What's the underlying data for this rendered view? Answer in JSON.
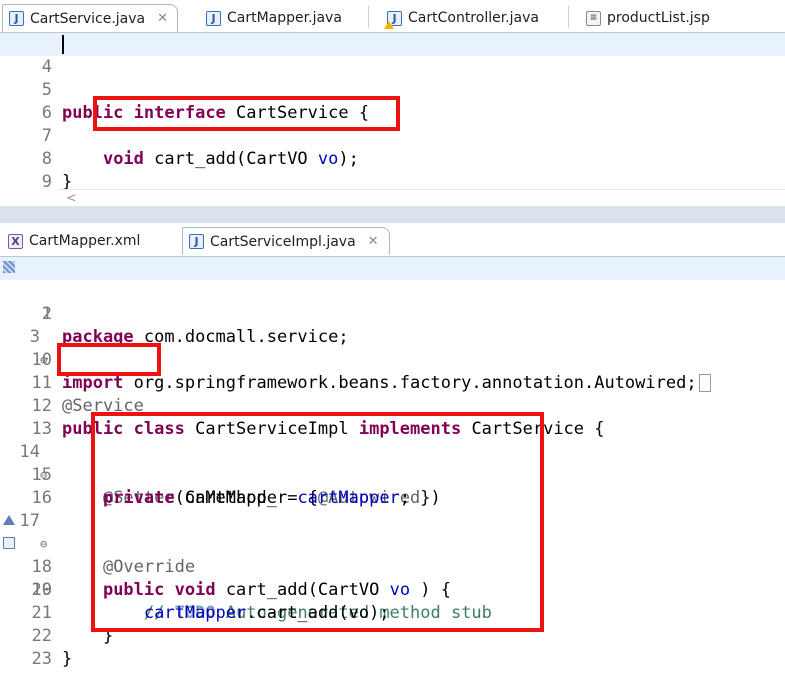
{
  "top_tabs": [
    {
      "label": "CartService.java",
      "icon": "java-file-icon",
      "active": true,
      "close": "✕"
    },
    {
      "label": "CartMapper.java",
      "icon": "java-file-icon"
    },
    {
      "label": "CartController.java",
      "icon": "java-file-warning-icon"
    },
    {
      "label": "productList.jsp",
      "icon": "jsp-file-icon"
    }
  ],
  "bottom_tabs": [
    {
      "label": "CartMapper.xml",
      "icon": "xml-file-icon"
    },
    {
      "label": "CartServiceImpl.java",
      "icon": "java-file-icon",
      "active": true,
      "close": "✕"
    }
  ],
  "top_editor": {
    "lines": [
      {
        "num": "4"
      },
      {
        "num": "5",
        "tokens": [
          [
            "kw",
            "public"
          ],
          [
            "",
            "  "
          ],
          [
            "kw",
            "interface"
          ],
          [
            "",
            " CartService {"
          ]
        ]
      },
      {
        "num": "6"
      },
      {
        "num": "7",
        "tokens": [
          [
            "",
            "    "
          ],
          [
            "kw",
            "void"
          ],
          [
            "",
            " cart_add(CartVO "
          ],
          [
            "fld",
            "vo"
          ],
          [
            "",
            ");"
          ]
        ]
      },
      {
        "num": "8",
        "tokens": [
          [
            "",
            "}"
          ]
        ]
      },
      {
        "num": "9"
      }
    ],
    "scroll_indicator": "<"
  },
  "bottom_editor": {
    "lines": [
      {
        "num": "1",
        "tokens": [
          [
            "kw",
            "package"
          ],
          [
            "",
            " com.docmall.service;"
          ]
        ]
      },
      {
        "num": "2"
      },
      {
        "num": "3",
        "fold": "⊕",
        "tokens": [
          [
            "kw",
            "import"
          ],
          [
            "",
            " org.springframework.beans.factory.annotation.Autowired;"
          ]
        ]
      },
      {
        "num": "10"
      },
      {
        "num": "11",
        "tokens": [
          [
            "ann",
            "@Service"
          ]
        ]
      },
      {
        "num": "12",
        "tokens": [
          [
            "kw",
            "public"
          ],
          [
            "",
            ""
          ],
          [
            "kw",
            " class"
          ],
          [
            "",
            " CartServiceImpl "
          ],
          [
            "kw",
            "implements"
          ],
          [
            "",
            " CartService {"
          ]
        ]
      },
      {
        "num": "13"
      },
      {
        "num": "14",
        "fold": "⊖",
        "tokens": [
          [
            "",
            "    "
          ],
          [
            "ann",
            "@Setter"
          ],
          [
            "",
            "(onMethod_ = {"
          ],
          [
            "ann",
            "@Autowired"
          ],
          [
            "",
            "})"
          ]
        ]
      },
      {
        "num": "15",
        "tokens": [
          [
            "",
            "    "
          ],
          [
            "kw",
            "private"
          ],
          [
            "",
            " CartMapper "
          ],
          [
            "fld",
            "cartMapper"
          ],
          [
            "",
            ";"
          ]
        ]
      },
      {
        "num": "16"
      },
      {
        "num": "17",
        "fold": "⊖",
        "tokens": [
          [
            "",
            "    "
          ],
          [
            "ann",
            "@Override"
          ]
        ]
      },
      {
        "num": "18",
        "tokens": [
          [
            "",
            "    "
          ],
          [
            "kw",
            "public"
          ],
          [
            "",
            " "
          ],
          [
            "kw",
            "void"
          ],
          [
            "",
            " cart_add(CartVO "
          ],
          [
            "fld",
            "vo"
          ],
          [
            "",
            " ) {"
          ]
        ]
      },
      {
        "num": "19",
        "tokens": [
          [
            "",
            "        "
          ],
          [
            "cmt",
            "// "
          ],
          [
            "todo",
            "TODO"
          ],
          [
            "cmt",
            " Auto-generated method stub"
          ]
        ]
      },
      {
        "num": "20",
        "tokens": [
          [
            "",
            "        "
          ],
          [
            "fld",
            "cartMapper"
          ],
          [
            "",
            ".cart_add(vo);"
          ]
        ]
      },
      {
        "num": "21",
        "tokens": [
          [
            "",
            "    }"
          ]
        ]
      },
      {
        "num": "22",
        "tokens": [
          [
            "",
            "}"
          ]
        ]
      },
      {
        "num": "23"
      }
    ]
  },
  "colors": {
    "keyword": "#7f0055",
    "annotation": "#646464",
    "field": "#0000c0",
    "comment": "#3f7f5f",
    "highlight_line": "#e8f2fe",
    "callout": "#ee1111"
  }
}
